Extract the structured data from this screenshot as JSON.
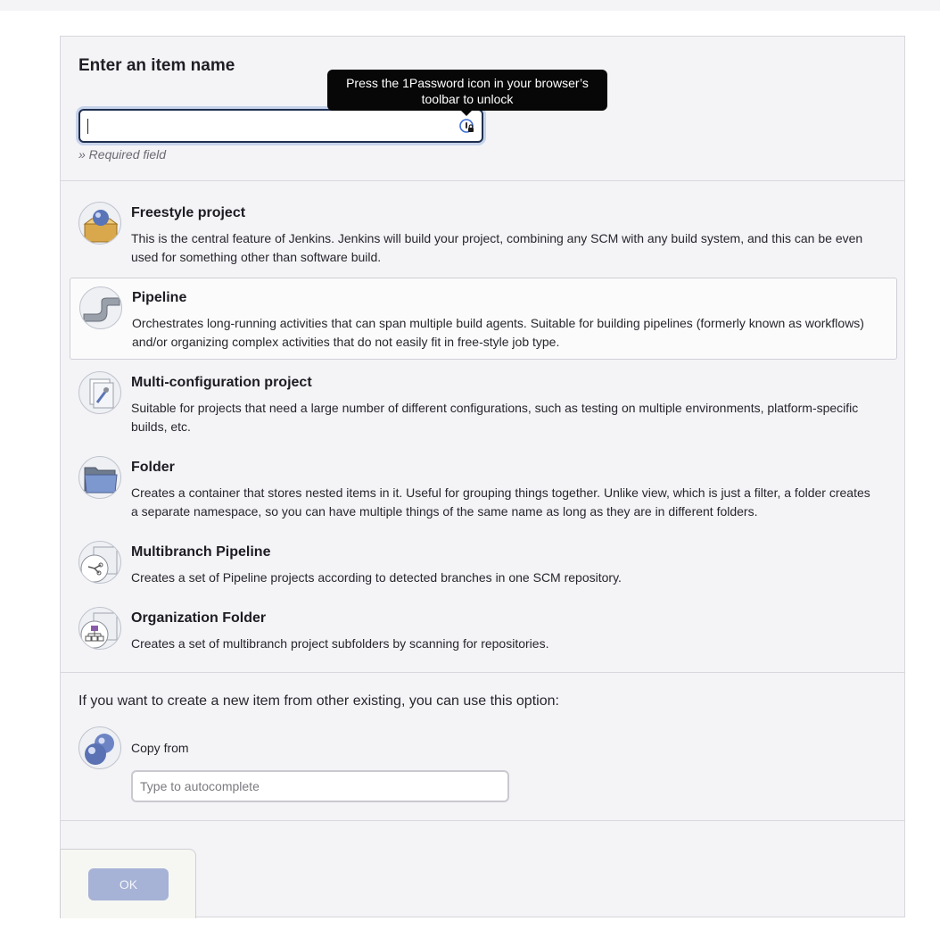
{
  "form": {
    "title": "Enter an item name",
    "name_value": "",
    "required_hint": "» Required field"
  },
  "tooltip": {
    "text": "Press the 1Password icon in your browser’s toolbar to unlock"
  },
  "item_types": [
    {
      "label": "Freestyle project",
      "description": "This is the central feature of Jenkins. Jenkins will build your project, combining any SCM with any build system, and this can be even used for something other than software build.",
      "icon": "freestyle-project-icon",
      "selected": false
    },
    {
      "label": "Pipeline",
      "description": "Orchestrates long-running activities that can span multiple build agents. Suitable for building pipelines (formerly known as workflows) and/or organizing complex activities that do not easily fit in free-style job type.",
      "icon": "pipeline-icon",
      "selected": true
    },
    {
      "label": "Multi-configuration project",
      "description": "Suitable for projects that need a large number of different configurations, such as testing on multiple environments, platform-specific builds, etc.",
      "icon": "multi-configuration-icon",
      "selected": false
    },
    {
      "label": "Folder",
      "description": "Creates a container that stores nested items in it. Useful for grouping things together. Unlike view, which is just a filter, a folder creates a separate namespace, so you can have multiple things of the same name as long as they are in different folders.",
      "icon": "folder-icon",
      "selected": false
    },
    {
      "label": "Multibranch Pipeline",
      "description": "Creates a set of Pipeline projects according to detected branches in one SCM repository.",
      "icon": "multibranch-pipeline-icon",
      "selected": false
    },
    {
      "label": "Organization Folder",
      "description": "Creates a set of multibranch project subfolders by scanning for repositories.",
      "icon": "organization-folder-icon",
      "selected": false
    }
  ],
  "copy": {
    "intro": "If you want to create a new item from other existing, you can use this option:",
    "label": "Copy from",
    "placeholder": "Type to autocomplete",
    "value": ""
  },
  "actions": {
    "ok_label": "OK"
  },
  "colors": {
    "accent": "#1f2f4f",
    "ok_button": "#a6b2d6",
    "tooltip_bg": "#070707",
    "panel_bg": "#f4f4f7"
  }
}
